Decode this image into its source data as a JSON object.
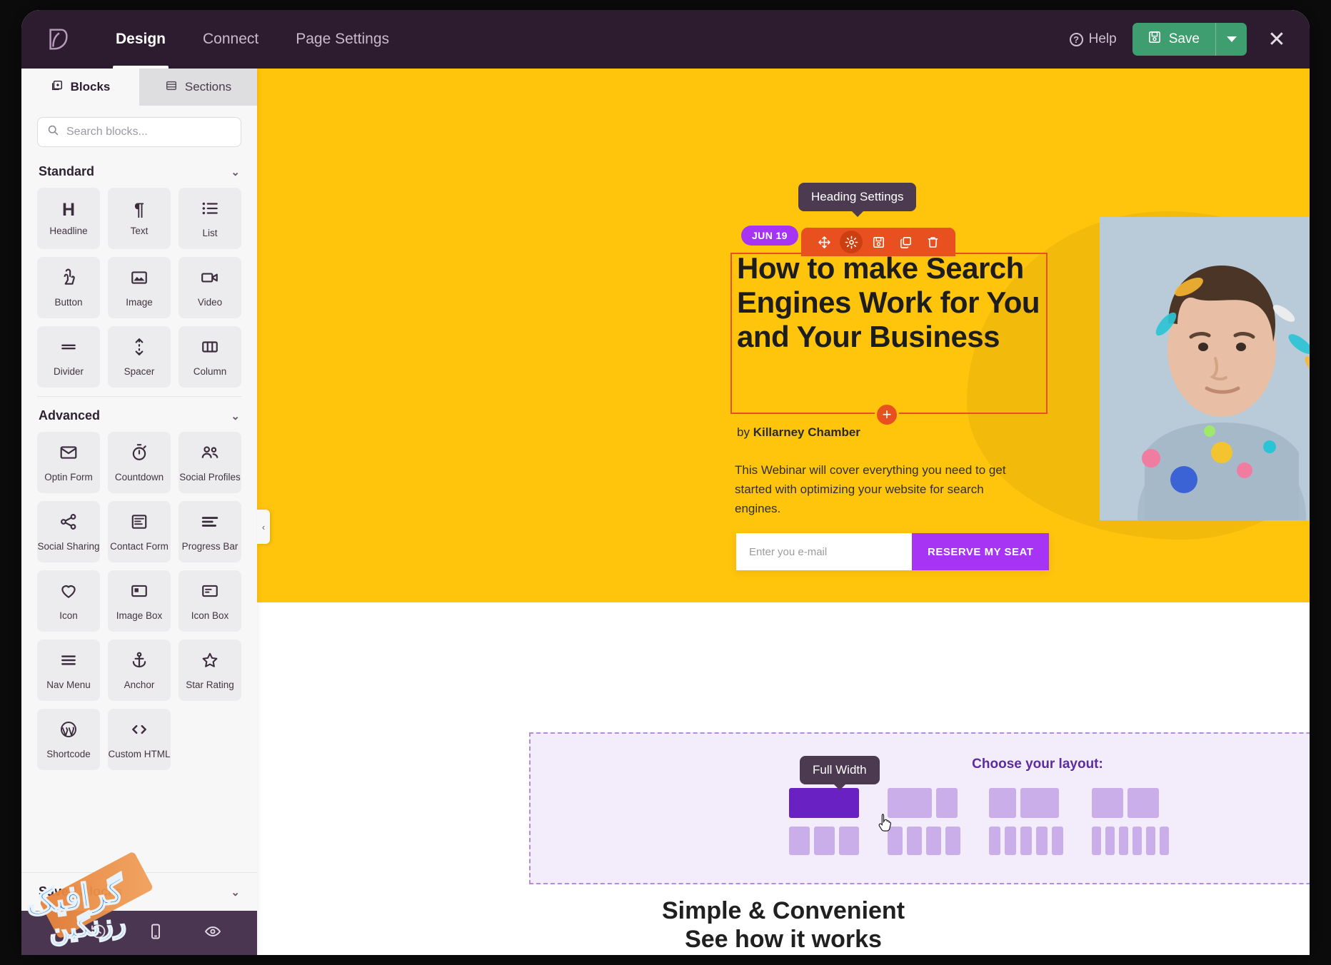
{
  "topbar": {
    "logo_icon": "leaf-logo-icon",
    "tabs": [
      {
        "label": "Design",
        "active": true
      },
      {
        "label": "Connect",
        "active": false
      },
      {
        "label": "Page Settings",
        "active": false
      }
    ],
    "help_label": "Help",
    "save_label": "Save",
    "save_icon": "floppy-disk-icon",
    "save_caret_icon": "chevron-down-icon",
    "close_icon": "close-icon"
  },
  "sidebar": {
    "tabs": [
      {
        "label": "Blocks",
        "icon": "blocks-icon",
        "active": true
      },
      {
        "label": "Sections",
        "icon": "sections-icon",
        "active": false
      }
    ],
    "search": {
      "placeholder": "Search blocks...",
      "value": "",
      "icon": "search-icon"
    },
    "groups": [
      {
        "title": "Standard",
        "chevron": "chevron-down-icon",
        "items": [
          {
            "label": "Headline",
            "icon": "headline-h-icon"
          },
          {
            "label": "Text",
            "icon": "pilcrow-icon"
          },
          {
            "label": "List",
            "icon": "list-icon"
          },
          {
            "label": "Button",
            "icon": "button-click-icon"
          },
          {
            "label": "Image",
            "icon": "image-icon"
          },
          {
            "label": "Video",
            "icon": "video-camera-icon"
          },
          {
            "label": "Divider",
            "icon": "divider-icon"
          },
          {
            "label": "Spacer",
            "icon": "spacer-arrows-icon"
          },
          {
            "label": "Column",
            "icon": "column-icon"
          }
        ]
      },
      {
        "title": "Advanced",
        "chevron": "chevron-down-icon",
        "items": [
          {
            "label": "Optin Form",
            "icon": "envelope-icon"
          },
          {
            "label": "Countdown",
            "icon": "stopwatch-icon"
          },
          {
            "label": "Social Profiles",
            "icon": "people-icon"
          },
          {
            "label": "Social Sharing",
            "icon": "share-icon"
          },
          {
            "label": "Contact Form",
            "icon": "form-icon"
          },
          {
            "label": "Progress Bar",
            "icon": "progress-bar-icon"
          },
          {
            "label": "Icon",
            "icon": "heart-icon"
          },
          {
            "label": "Image Box",
            "icon": "image-box-icon"
          },
          {
            "label": "Icon Box",
            "icon": "icon-box-icon"
          },
          {
            "label": "Nav Menu",
            "icon": "hamburger-icon"
          },
          {
            "label": "Anchor",
            "icon": "anchor-icon"
          },
          {
            "label": "Star Rating",
            "icon": "star-icon"
          },
          {
            "label": "Shortcode",
            "icon": "wordpress-icon"
          },
          {
            "label": "Custom HTML",
            "icon": "code-brackets-icon"
          }
        ]
      }
    ],
    "saved_blocks": {
      "title": "Saved Blocks",
      "chevron": "chevron-down-icon"
    },
    "bottom_tools": [
      {
        "icon": "revision-history-icon"
      },
      {
        "icon": "mobile-preview-icon"
      },
      {
        "icon": "eye-preview-icon"
      }
    ],
    "collapse_icon": "chevron-left-icon"
  },
  "canvas": {
    "heading_tooltip": "Heading Settings",
    "element_toolbar": [
      {
        "icon": "move-icon",
        "active": false
      },
      {
        "icon": "gear-icon",
        "active": true
      },
      {
        "icon": "save-block-icon",
        "active": false
      },
      {
        "icon": "duplicate-icon",
        "active": false
      },
      {
        "icon": "trash-icon",
        "active": false
      }
    ],
    "date_badge": "JUN 19",
    "headline": "How to make Search Engines Work for You and Your Business",
    "add_block_icon": "plus-circle-icon",
    "byline_prefix": "by ",
    "byline_author": "Killarney Chamber",
    "subcopy": "This Webinar will cover everything you need to get started with optimizing your website for search engines.",
    "optin": {
      "placeholder": "Enter you e-mail",
      "value": "",
      "button_label": "RESERVE MY SEAT"
    },
    "hero_image_alt": "portrait-photo"
  },
  "chooser": {
    "tooltip": "Full Width",
    "title": "Choose your layout:",
    "close_icon": "close-icon",
    "rows": [
      {
        "columns": [
          1
        ],
        "selected": true
      },
      {
        "columns": [
          1,
          1
        ],
        "selected": false
      },
      {
        "columns": [
          1,
          1
        ],
        "selected": false
      },
      {
        "columns": [
          1,
          1
        ],
        "selected": false
      },
      {
        "columns": [
          1,
          1,
          1
        ],
        "selected": false
      },
      {
        "columns": [
          1,
          1,
          1,
          1
        ],
        "selected": false
      },
      {
        "columns": [
          1,
          1,
          1,
          1
        ],
        "selected": false
      },
      {
        "columns": [
          1,
          1,
          1,
          1,
          1
        ],
        "selected": false
      }
    ],
    "cursor_icon": "pointer-cursor-icon"
  },
  "bottom_section": {
    "line1": "Simple & Convenient",
    "line2": "See how it works"
  },
  "watermark": {
    "line1": "گرافیک",
    "line2": "رزنگین"
  },
  "colors": {
    "topbar_bg": "#2d1b30",
    "save_green": "#3f9e6f",
    "hero_yellow": "#ffc40c",
    "accent_orange": "#e8501f",
    "accent_purple": "#a734f5",
    "chooser_bg": "#f3ecfb",
    "chooser_selected": "#6a21c4",
    "chooser_cell": "#c9aeea"
  }
}
